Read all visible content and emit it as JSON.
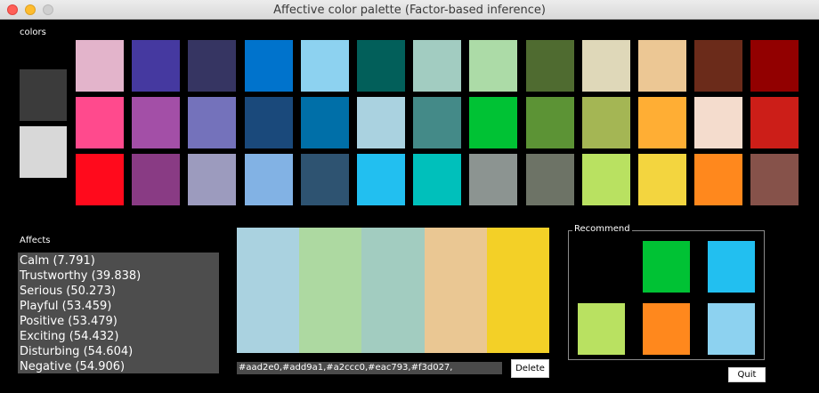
{
  "window": {
    "title": "Affective color palette (Factor-based inference)"
  },
  "colors_section": {
    "label": "colors"
  },
  "preview": {
    "top_color": "#3b3b3b",
    "bottom_color": "#d8d8d8"
  },
  "color_grid": [
    [
      "#e3b4cb",
      "#4539a0",
      "#363562",
      "#0073cc",
      "#8dd2f0",
      "#025f5a",
      "#a2ccc1",
      "#acdba7",
      "#4f6b30",
      "#dfd8b9",
      "#ecc794",
      "#6b2b1a",
      "#920000"
    ],
    [
      "#ff4a8d",
      "#a34fa7",
      "#7472bb",
      "#1a497b",
      "#006fa8",
      "#aad2e0",
      "#448a88",
      "#00c234",
      "#5c9335",
      "#a4b654",
      "#ffae34",
      "#f4dccd",
      "#cc1e18"
    ],
    [
      "#ff0a1c",
      "#893b84",
      "#9c9bbe",
      "#82b2e4",
      "#2e5371",
      "#22bff0",
      "#00c0bb",
      "#8c9491",
      "#6d7366",
      "#b9e161",
      "#f3d53f",
      "#ff881d",
      "#86524a"
    ]
  ],
  "affects": {
    "label": "Affects",
    "items": [
      "Calm (7.791)",
      "Trustworthy (39.838)",
      "Serious (50.273)",
      "Playful (53.459)",
      "Positive (53.479)",
      "Exciting (54.432)",
      "Disturbing (54.604)",
      "Negative (54.906)"
    ]
  },
  "palette": {
    "colors": [
      "#aad2e0",
      "#add9a1",
      "#a2ccc0",
      "#eac793",
      "#f3d027"
    ],
    "hex_value": "#aad2e0,#add9a1,#a2ccc0,#eac793,#f3d027,",
    "delete_label": "Delete"
  },
  "recommend": {
    "label": "Recommend",
    "row1": [
      "#00c234",
      "#22bff0"
    ],
    "row2": [
      "#b9e161",
      "#ff881d",
      "#8dd2f0"
    ]
  },
  "quit_label": "Quit"
}
